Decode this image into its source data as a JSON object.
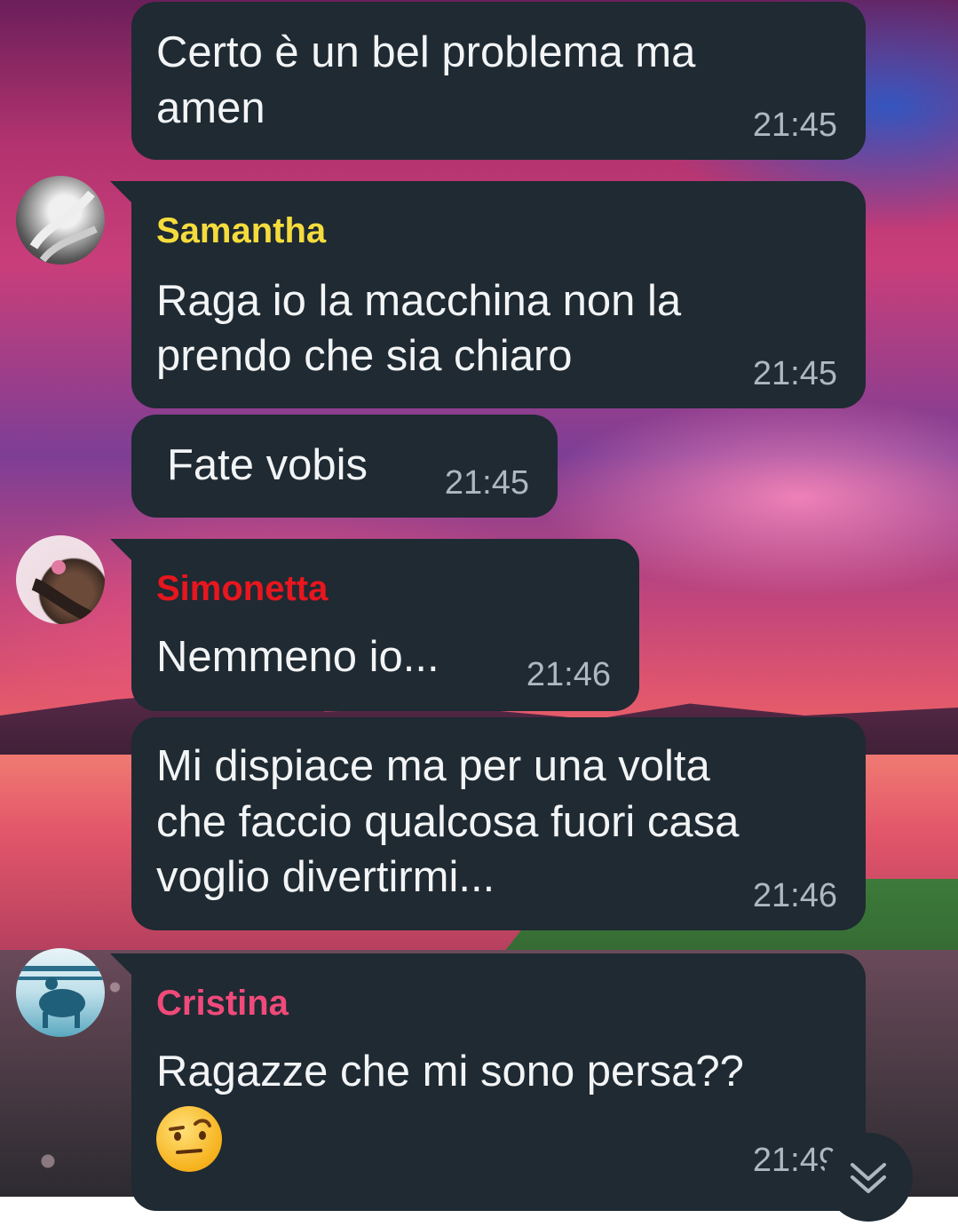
{
  "messages": [
    {
      "text_line1": "Certo è un bel problema ma",
      "text_line2": "amen",
      "time": "21:45"
    },
    {
      "sender": "Samantha",
      "sender_color": "#f5dc3c",
      "text_line1": "Raga io la macchina non la",
      "text_line2": "prendo che sia chiaro",
      "time": "21:45"
    },
    {
      "text_line1": "Fate vobis",
      "time": "21:45"
    },
    {
      "sender": "Simonetta",
      "sender_color": "#e8161e",
      "text_line1": "Nemmeno io...",
      "time": "21:46"
    },
    {
      "text_line1": "Mi dispiace ma per una volta",
      "text_line2": "che faccio qualcosa fuori casa",
      "text_line3": "voglio divertirmi...",
      "time": "21:46"
    },
    {
      "sender": "Cristina",
      "sender_color": "#f04a7a",
      "text_line1": "Ragazze che mi sono persa??",
      "emoji": "face-with-raised-eyebrow",
      "time": "21:49"
    }
  ],
  "colors": {
    "bubble": "#1f2a33",
    "time": "#aeb8c0"
  },
  "icons": {
    "scroll_down": "double-chevron-down-icon"
  }
}
